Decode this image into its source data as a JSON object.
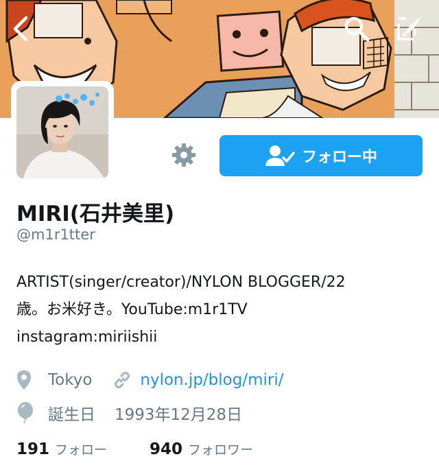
{
  "header": {
    "back_icon": "chevron-left-icon",
    "search_icon": "search-icon",
    "compose_icon": "compose-icon"
  },
  "profile": {
    "name": "MIRI(石井美里)",
    "handle": "@m1r1tter",
    "follow_button_label": "フォロー中",
    "bio_lines": [
      "ARTIST(singer/creator)/NYLON BLOGGER/22",
      "歳。お米好き。YouTube:m1r1TV",
      "instagram:miriishii"
    ],
    "location": "Tokyo",
    "website": "nylon.jp/blog/miri/",
    "birthday_label": "誕生日",
    "birthday_value": "1993年12月28日"
  },
  "stats": {
    "following_count": "191",
    "following_label": "フォロー",
    "followers_count": "940",
    "followers_label": "フォロワー"
  },
  "colors": {
    "accent": "#1da1f2",
    "link": "#1b95e0",
    "secondary_text": "#657786"
  }
}
